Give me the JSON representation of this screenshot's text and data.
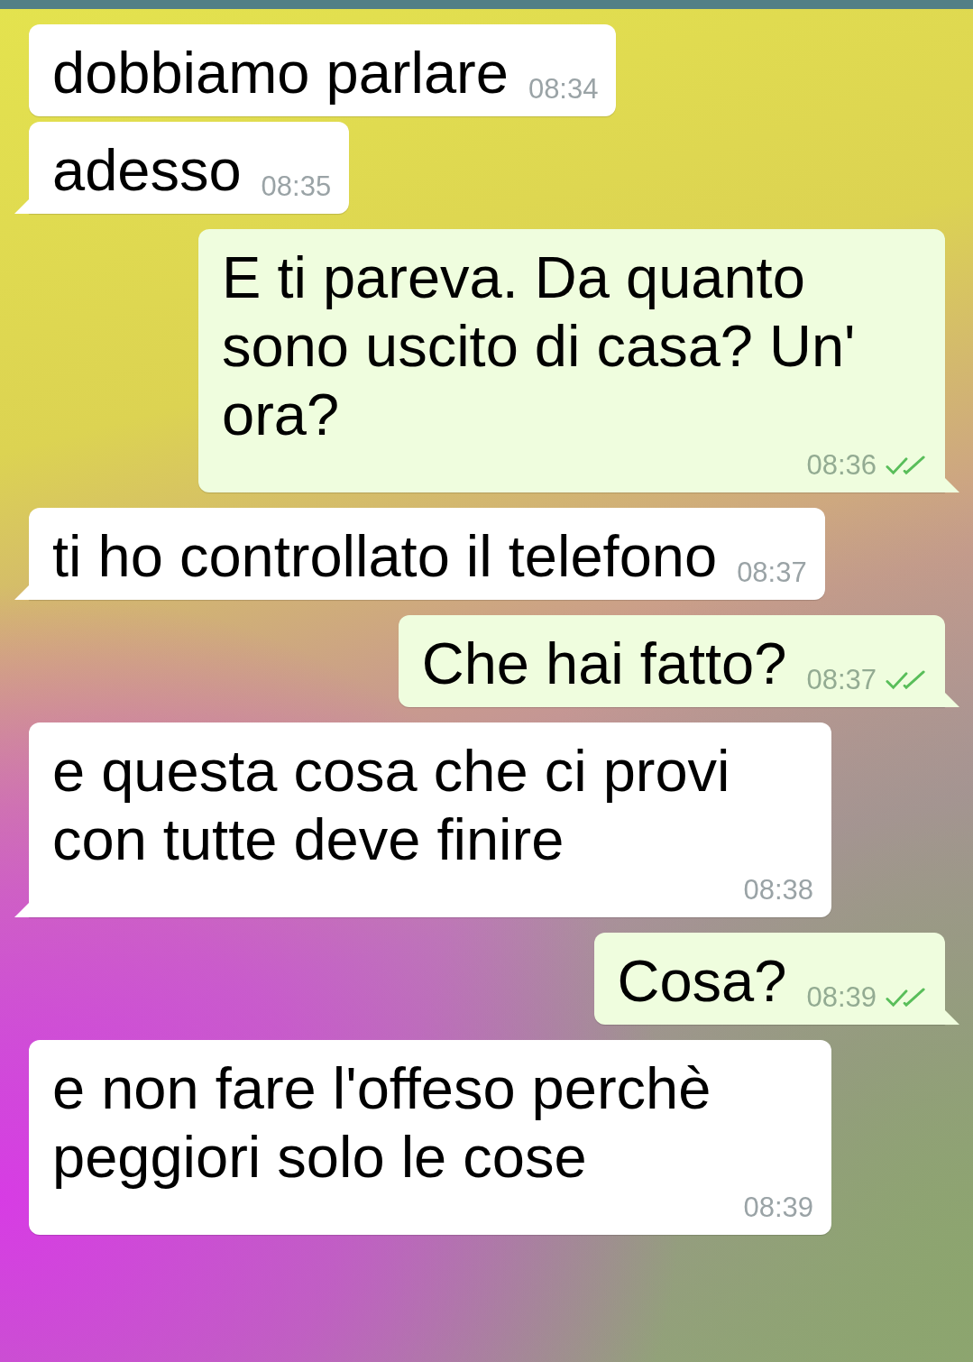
{
  "messages": [
    {
      "kind": "in",
      "text": "dobbiamo parlare",
      "time": "08:34",
      "tail": false
    },
    {
      "kind": "in",
      "text": "adesso",
      "time": "08:35",
      "tail": true
    },
    {
      "kind": "out",
      "text": "E ti pareva. Da quanto sono uscito di casa? Un' ora?",
      "time": "08:36",
      "tail": true,
      "read": true
    },
    {
      "kind": "in",
      "text": "ti ho controllato il telefono",
      "time": "08:37",
      "tail": true
    },
    {
      "kind": "out",
      "text": "Che hai fatto?",
      "time": "08:37",
      "tail": true,
      "read": true
    },
    {
      "kind": "in",
      "text": "e questa cosa che ci provi con tutte deve finire",
      "time": "08:38",
      "tail": true
    },
    {
      "kind": "out",
      "text": "Cosa?",
      "time": "08:39",
      "tail": true,
      "read": true
    },
    {
      "kind": "in",
      "text": "e non fare l'offeso perchè peggiori solo le cose",
      "time": "08:39",
      "tail": false
    }
  ]
}
